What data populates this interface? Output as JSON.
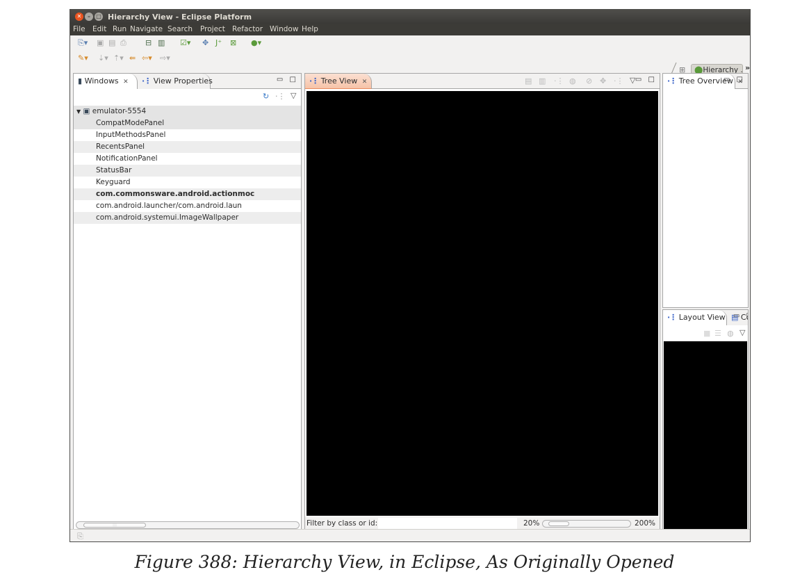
{
  "window": {
    "title": "Hierarchy View - Eclipse Platform",
    "controls": {
      "close": "✕",
      "minimize": "–",
      "maximize": "□"
    }
  },
  "menubar": {
    "items": [
      "File",
      "Edit",
      "Run",
      "Navigate",
      "Search",
      "Project",
      "Refactor",
      "Window",
      "Help"
    ]
  },
  "toolbar": {
    "perspective_label": "Hierarchy ..",
    "more_label": "»",
    "icon_names": [
      "new-icon",
      "save-icon",
      "save-all-icon",
      "print-icon",
      "sdk-manager-icon",
      "avd-manager-icon",
      "lint-icon",
      "new-project-icon",
      "new-java-class-icon",
      "new-xml-icon",
      "run-icon",
      "pin-icon",
      "next-annotation-icon",
      "prev-annotation-icon",
      "last-edit-icon",
      "back-icon",
      "forward-icon",
      "open-perspective-icon",
      "hierarchy-perspective-icon"
    ]
  },
  "windows_panel": {
    "tabs": [
      {
        "label": "Windows",
        "icon": "device-icon",
        "active": true
      },
      {
        "label": "View Properties",
        "icon": "hierarchy-icon",
        "active": false
      }
    ],
    "toolbar_icons": [
      "refresh-icon",
      "load-hierarchy-icon",
      "view-menu-icon"
    ],
    "device": "emulator-5554",
    "windows": [
      {
        "label": "CompatModePanel",
        "bold": false
      },
      {
        "label": "InputMethodsPanel",
        "bold": false
      },
      {
        "label": "RecentsPanel",
        "bold": false
      },
      {
        "label": "NotificationPanel",
        "bold": false
      },
      {
        "label": "StatusBar",
        "bold": false
      },
      {
        "label": "Keyguard",
        "bold": false
      },
      {
        "label": "com.commonsware.android.actionmoc",
        "bold": true
      },
      {
        "label": "com.android.launcher/com.android.laun",
        "bold": false
      },
      {
        "label": "com.android.systemui.ImageWallpaper",
        "bold": false
      }
    ]
  },
  "tree_panel": {
    "tab_label": "Tree View",
    "toolbar_icons": [
      "save-png-icon",
      "capture-layers-icon",
      "load-view-hierarchy-icon",
      "display-view-icon",
      "invalidate-icon",
      "request-layout-icon",
      "dump-displaylist-icon",
      "view-menu-icon"
    ],
    "filter_label": "Filter by class or id:",
    "filter_value": "",
    "zoom_min": "20%",
    "zoom_max": "200%",
    "zoom_level": 0.05
  },
  "overview_panel": {
    "tab_label": "Tree Overview"
  },
  "layout_panel": {
    "tabs": [
      {
        "label": "Layout View",
        "active": true
      },
      {
        "label": "Console",
        "active": false
      }
    ]
  },
  "caption": "Figure 388: Hierarchy View, in Eclipse, As Originally Opened",
  "colors": {
    "title_bar": "#3c3b37",
    "active_tab": "#f6c3a8",
    "close_button": "#e95420",
    "canvas": "#000000"
  }
}
